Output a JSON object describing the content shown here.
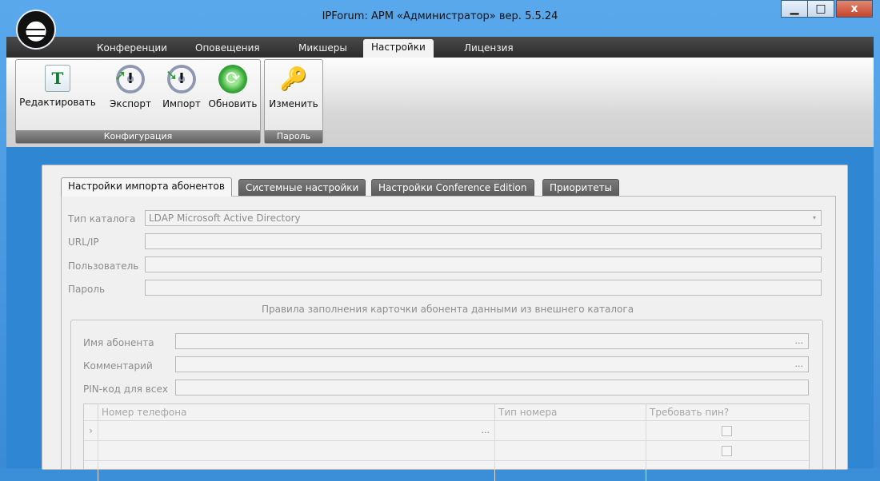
{
  "window": {
    "title": "IPForum: АРМ «Администратор» вер. 5.5.24",
    "minimize": "▁",
    "maximize": "□",
    "close": "x"
  },
  "menu": [
    "Конференции",
    "Оповещения",
    "Микшеры",
    "Настройки",
    "Лицензия"
  ],
  "ribbon": {
    "groups": [
      {
        "label": "Конфигурация",
        "buttons": [
          "Редактировать",
          "Экспорт",
          "Импорт",
          "Обновить"
        ]
      },
      {
        "label": "Пароль",
        "buttons": [
          "Изменить"
        ]
      }
    ]
  },
  "settings_tabs": [
    "Настройки импорта абонентов",
    "Системные настройки",
    "Настройки Conference Edition",
    "Приоритеты"
  ],
  "form": {
    "catalog_type_label": "Тип каталога",
    "catalog_type_value": "LDAP Microsoft Active Directory",
    "url_label": "URL/IP",
    "user_label": "Пользователь",
    "password_label": "Пароль",
    "rules_caption": "Правила заполнения карточки абонента данными из внешнего каталога",
    "name_label": "Имя абонента",
    "comment_label": "Комментарий",
    "pin_label": "PIN-код для всех",
    "ellipsis": "..."
  },
  "grid": {
    "columns": [
      "Номер телефона",
      "Тип номера",
      "Требовать пин?"
    ],
    "row_marker": "›"
  }
}
